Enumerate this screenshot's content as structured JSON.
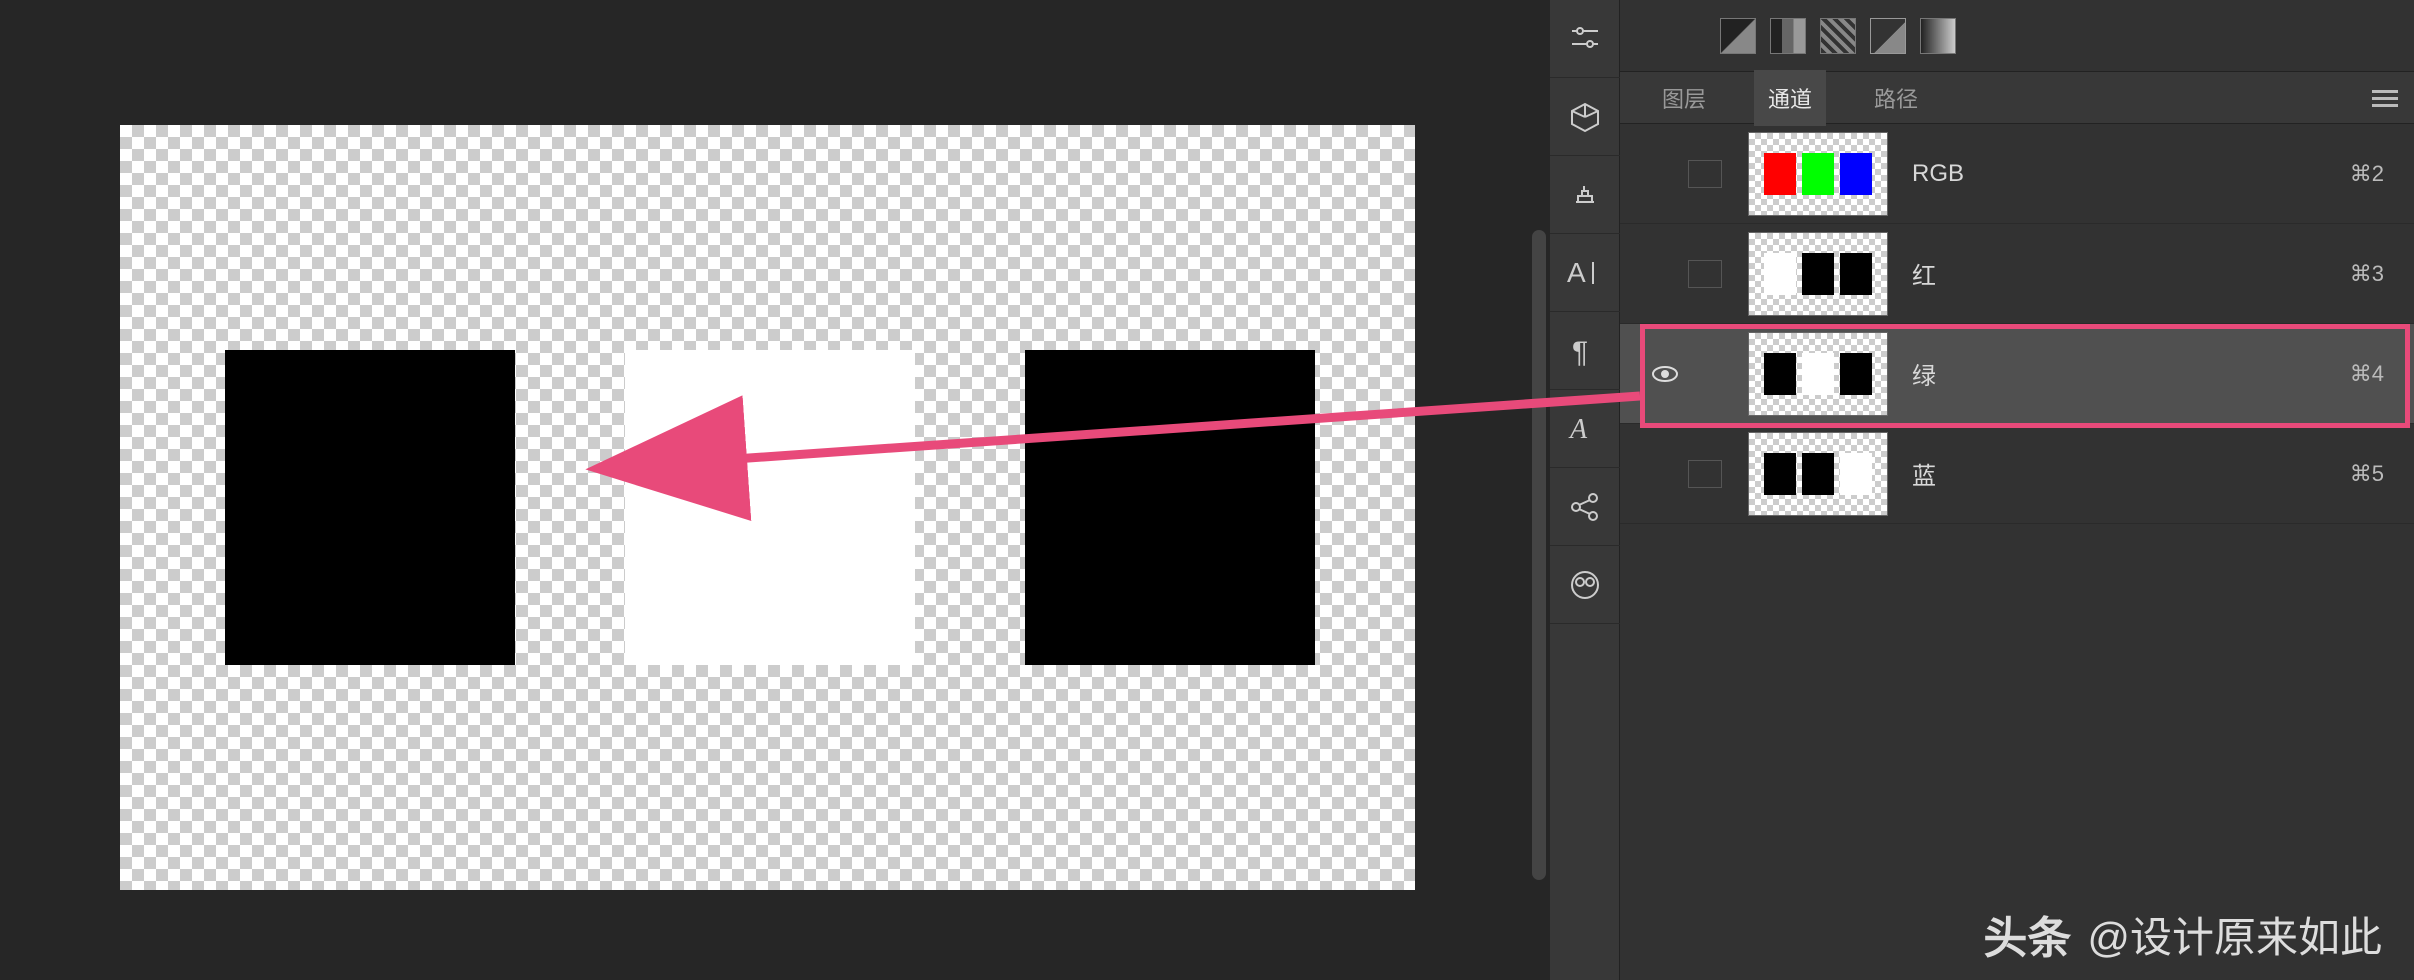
{
  "canvas": {
    "squares": [
      {
        "fill": "#000000"
      },
      {
        "fill": "#ffffff"
      },
      {
        "fill": "#000000"
      }
    ]
  },
  "top_icons": [
    "adjust",
    "diag-stripes",
    "levels",
    "envelope",
    "gradient"
  ],
  "tabs": {
    "layers": "图层",
    "channels": "通道",
    "paths": "路径",
    "active": "channels"
  },
  "channels": [
    {
      "id": "rgb",
      "label": "RGB",
      "shortcut": "⌘2",
      "minis": [
        "#ff0000",
        "#00ff00",
        "#0000ff"
      ],
      "visible": false,
      "selected": false
    },
    {
      "id": "red",
      "label": "红",
      "shortcut": "⌘3",
      "minis": [
        "#ffffff",
        "#000000",
        "#000000"
      ],
      "visible": false,
      "selected": false
    },
    {
      "id": "green",
      "label": "绿",
      "shortcut": "⌘4",
      "minis": [
        "#000000",
        "#ffffff",
        "#000000"
      ],
      "visible": true,
      "selected": true
    },
    {
      "id": "blue",
      "label": "蓝",
      "shortcut": "⌘5",
      "minis": [
        "#000000",
        "#000000",
        "#ffffff"
      ],
      "visible": false,
      "selected": false
    }
  ],
  "annotation": {
    "highlight_channel": "green",
    "arrow_color": "#e84a7a"
  },
  "watermark": {
    "logo": "头条",
    "handle": "@设计原来如此"
  }
}
